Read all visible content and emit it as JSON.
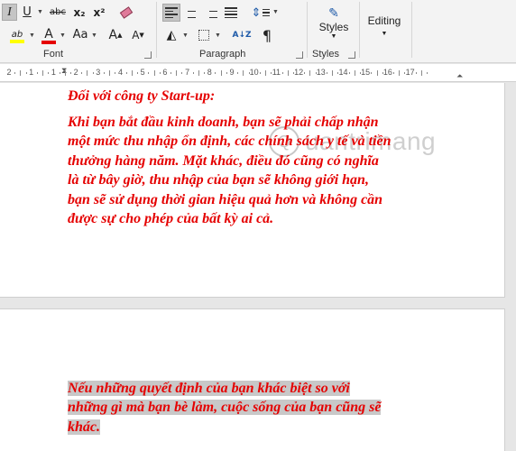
{
  "ribbon": {
    "font_group_label": "Font",
    "paragraph_group_label": "Paragraph",
    "styles_group_label": "Styles",
    "styles_button_label": "Styles",
    "editing_button_label": "Editing",
    "italic_glyph": "I",
    "underline_glyph": "U",
    "strikethrough_glyph": "abc",
    "subscript_glyph": "x₂",
    "superscript_glyph": "x²",
    "highlight_glyph": "ab",
    "font_color_glyph": "A",
    "change_case_glyph": "Aa",
    "grow_font_glyph": "A",
    "shrink_font_glyph": "A",
    "pilcrow_glyph": "¶",
    "highlight_color": "#ffff00",
    "font_color": "#e50000"
  },
  "ruler": {
    "numbers": [
      "2",
      "1",
      "1",
      "2",
      "3",
      "4",
      "5",
      "6",
      "7",
      "8",
      "9",
      "10",
      "11",
      "12",
      "13",
      "14",
      "15",
      "16",
      "17"
    ]
  },
  "watermark": {
    "text": "uantrimang",
    "logo_glyph": "Q"
  },
  "document": {
    "heading": "Đối với công ty Start-up:",
    "paragraph1_lines": [
      "Khi bạn bắt đầu kinh doanh, bạn sẽ phải chấp nhận",
      "một mức thu nhập ổn định, các chính sách y tế và tiền",
      "thưởng hàng năm. Mặt khác, điều đó cũng có nghĩa",
      "là từ bây giờ, thu nhập của bạn sẽ không giới hạn,",
      "bạn sẽ sử dụng thời gian hiệu quả hơn và không cần",
      "được sự cho phép của bất kỳ ai cả."
    ],
    "paragraph2_lines": [
      "Nếu những quyết định của bạn khác biệt so với",
      "những gì mà bạn bè làm, cuộc sống của bạn cũng sẽ",
      "khác."
    ],
    "text_color": "#e50000",
    "selection_color": "#c8c8c8"
  }
}
